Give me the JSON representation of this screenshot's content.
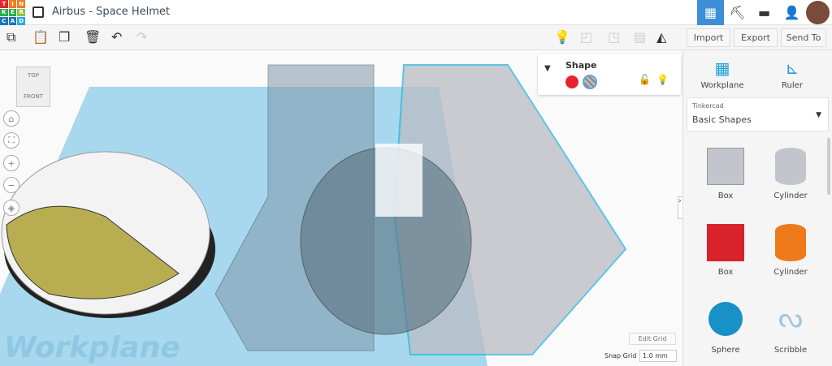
{
  "logo": {
    "letters": [
      "T",
      "I",
      "N",
      "K",
      "E",
      "R",
      "C",
      "A",
      "D"
    ]
  },
  "header": {
    "title": "Airbus - Space Helmet"
  },
  "toolbar": {
    "import": "Import",
    "export": "Export",
    "send_to": "Send To"
  },
  "viewcube": {
    "top": "TOP",
    "front": "FRONT"
  },
  "shape_panel": {
    "title": "Shape",
    "solid_color": "#e8232f"
  },
  "right_panel": {
    "workplane": "Workplane",
    "ruler": "Ruler",
    "library_source": "Tinkercad",
    "library_name": "Basic Shapes",
    "shapes": [
      {
        "label": "Box"
      },
      {
        "label": "Cylinder"
      },
      {
        "label": "Box"
      },
      {
        "label": "Cylinder"
      },
      {
        "label": "Sphere"
      },
      {
        "label": "Scribble"
      }
    ]
  },
  "viewport": {
    "workplane_label": "Workplane",
    "edit_grid": "Edit Grid",
    "snap_grid_label": "Snap Grid",
    "snap_grid_value": "1.0 mm"
  }
}
